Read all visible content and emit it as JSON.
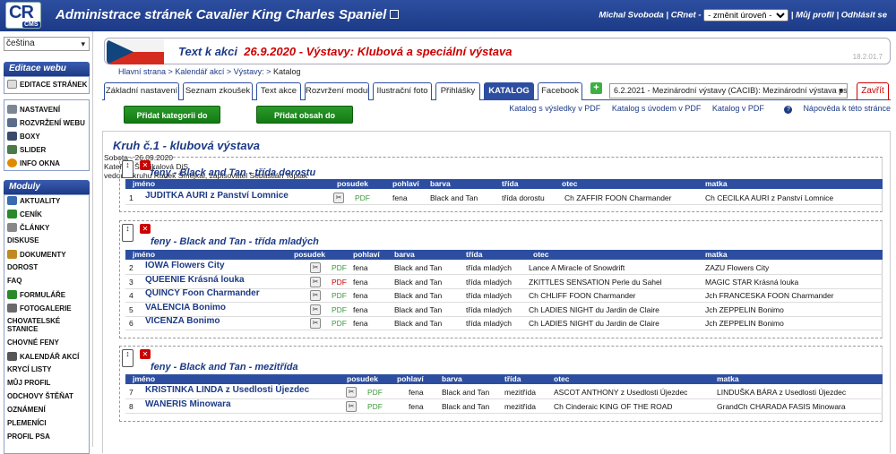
{
  "header": {
    "logo_text": "CR",
    "logo_sub": "CMS",
    "title": "Administrace stránek Cavalier King Charles Spaniel",
    "user": "Michal Svoboda",
    "sep1": "|",
    "crnet_label": "CRnet -",
    "level_select": "- změnit úroveň -",
    "sep2": "|",
    "profile_link": "Můj profil",
    "sep3": "|",
    "logout_link": "Odhlásit se"
  },
  "sidebar": {
    "language": "čeština",
    "edit_web_title": "Editace webu",
    "edit_pages": "EDITACE STRÁNEK",
    "web_items": [
      {
        "label": "NASTAVENÍ",
        "icon": "gear-icon",
        "color": "#7b8794"
      },
      {
        "label": "ROZVRŽENÍ WEBU",
        "icon": "layout-icon",
        "color": "#5a6c8a"
      },
      {
        "label": "BOXY",
        "icon": "box-icon",
        "color": "#3a4a6a"
      },
      {
        "label": "SLIDER",
        "icon": "slider-icon",
        "color": "#4a7a4a"
      },
      {
        "label": "INFO OKNA",
        "icon": "info-icon",
        "color": "#e08a00"
      }
    ],
    "modules_title": "Moduly",
    "module_items": [
      {
        "label": "AKTUALITY",
        "icon": "news-icon",
        "color": "#3a6ab0"
      },
      {
        "label": "CENÍK",
        "icon": "dollar-icon",
        "color": "#2a8a2a"
      },
      {
        "label": "ČLÁNKY",
        "icon": "article-icon",
        "color": "#888"
      },
      {
        "label": "DISKUSE",
        "icon": "",
        "color": ""
      },
      {
        "label": "DOKUMENTY",
        "icon": "document-icon",
        "color": "#c08a20"
      },
      {
        "label": "DOROST",
        "icon": "",
        "color": ""
      },
      {
        "label": "FAQ",
        "icon": "",
        "color": ""
      },
      {
        "label": "FORMULÁŘE",
        "icon": "form-icon",
        "color": "#2a8a2a"
      },
      {
        "label": "FOTOGALERIE",
        "icon": "gallery-icon",
        "color": "#6a6a6a"
      },
      {
        "label": "CHOVATELSKÉ STANICE",
        "icon": "",
        "color": ""
      },
      {
        "label": "CHOVNÉ FENY",
        "icon": "",
        "color": ""
      },
      {
        "label": "KALENDÁŘ AKCÍ",
        "icon": "calendar-icon",
        "color": "#555"
      },
      {
        "label": "KRYCÍ LISTY",
        "icon": "",
        "color": ""
      },
      {
        "label": "MŮJ PROFIL",
        "icon": "",
        "color": ""
      },
      {
        "label": "ODCHOVY ŠTĚŇAT",
        "icon": "",
        "color": ""
      },
      {
        "label": "OZNÁMENÍ",
        "icon": "",
        "color": ""
      },
      {
        "label": "PLEMENÍCI",
        "icon": "",
        "color": ""
      },
      {
        "label": "PROFIL PSA",
        "icon": "",
        "color": ""
      }
    ]
  },
  "main": {
    "heading_prefix": "Text k akci",
    "heading_event": "26.9.2020 - Výstavy: Klubová a speciální výstava",
    "version": "18.2.01.7",
    "breadcrumb": [
      "Hlavní strana",
      ">",
      "Kalendář akcí",
      ">",
      "Výstavy:",
      ">",
      "Katalog"
    ],
    "tabs": [
      "Základní nastavení",
      "Seznam zkoušek",
      "Text akce",
      "Rozvržení modulu",
      "Ilustrační foto",
      "Přihlášky",
      "KATALOG",
      "Facebook"
    ],
    "plus": "+",
    "event_select": "6.2.2021 - Mezinárodní výstavy (CACIB): Mezinárodní výstava ps...",
    "close_label": "Zavřít",
    "btn_add_category": "Přidat kategorii do kruhu",
    "btn_add_content": "Přidat obsah do katalogu",
    "links": {
      "results_pdf": "Katalog s výsledky v PDF",
      "intro_pdf": "Katalog s úvodem v PDF",
      "catalog_pdf": "Katalog v PDF",
      "help": "Nápověda k této stránce"
    },
    "ring_title": "Kruh č.1 - klubová výstava",
    "ring_info": [
      "Sobota - 26.09.2020",
      "Kateřina Šmejkalová DiS.",
      "vedoucí kruhu Radek Šmejkal, zapisovatel Sebastián Toplak"
    ]
  },
  "columns": [
    "jméno",
    "posudek",
    "pohlaví",
    "barva",
    "třída",
    "otec",
    "matka"
  ],
  "sections": [
    {
      "title": "feny - Black and Tan - třída dorostu",
      "rows": [
        {
          "no": "1",
          "name": "JUDITKA AURI z Panství Lomnice",
          "pdf": "PDF",
          "pdf_color": "green",
          "sex": "fena",
          "color": "Black and Tan",
          "class": "třída dorostu",
          "sire": "Ch ZAFFIR FOON Charmander",
          "dam": "Ch CECILKA AURI z Panství Lomnice"
        }
      ]
    },
    {
      "title": "feny - Black and Tan - třída mladých",
      "rows": [
        {
          "no": "2",
          "name": "IOWA Flowers City",
          "pdf": "PDF",
          "pdf_color": "green",
          "sex": "fena",
          "color": "Black and Tan",
          "class": "třída mladých",
          "sire": "Lance A Miracle of Snowdrift",
          "dam": "ZAZU Flowers City"
        },
        {
          "no": "3",
          "name": "QUEENIE Krásná louka",
          "pdf": "PDF",
          "pdf_color": "red",
          "sex": "fena",
          "color": "Black and Tan",
          "class": "třída mladých",
          "sire": "ZKITTLES SENSATION Perle du Sahel",
          "dam": "MAGIC STAR Krásná louka"
        },
        {
          "no": "4",
          "name": "QUINCY Foon Charmander",
          "pdf": "PDF",
          "pdf_color": "green",
          "sex": "fena",
          "color": "Black and Tan",
          "class": "třída mladých",
          "sire": "Ch CHLIFF FOON Charmander",
          "dam": "Jch FRANCESKA FOON Charmander"
        },
        {
          "no": "5",
          "name": "VALENCIA Bonimo",
          "pdf": "PDF",
          "pdf_color": "green",
          "sex": "fena",
          "color": "Black and Tan",
          "class": "třída mladých",
          "sire": "Ch LADIES NIGHT du Jardin de Claire",
          "dam": "Jch ZEPPELIN Bonimo"
        },
        {
          "no": "6",
          "name": "VICENZA Bonimo",
          "pdf": "PDF",
          "pdf_color": "green",
          "sex": "fena",
          "color": "Black and Tan",
          "class": "třída mladých",
          "sire": "Ch LADIES NIGHT du Jardin de Claire",
          "dam": "Jch ZEPPELIN Bonimo"
        }
      ]
    },
    {
      "title": "feny - Black and Tan - mezitřída",
      "rows": [
        {
          "no": "7",
          "name": "KRISTINKA LINDA z Usedlosti Újezdec",
          "pdf": "PDF",
          "pdf_color": "green",
          "sex": "fena",
          "color": "Black and Tan",
          "class": "mezitřída",
          "sire": "ASCOT ANTHONY z Usedlosti Újezdec",
          "dam": "LINDUŠKA BÁRA z Usedlosti Újezdec"
        },
        {
          "no": "8",
          "name": "WANERIS Minowara",
          "pdf": "PDF",
          "pdf_color": "green",
          "sex": "fena",
          "color": "Black and Tan",
          "class": "mezitřída",
          "sire": "Ch Cinderaic KING OF THE ROAD",
          "dam": "GrandCh CHARADA FASIS Minowara"
        }
      ]
    }
  ],
  "colors": {
    "primary": "#2d4ea0",
    "accent_red": "#c00",
    "button_green": "#137a13"
  }
}
